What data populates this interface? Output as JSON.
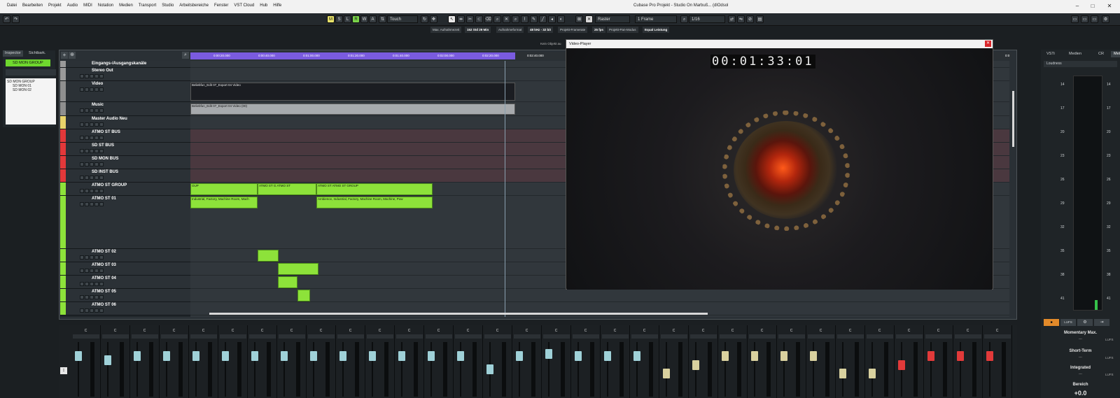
{
  "app": {
    "menu": [
      "Datei",
      "Bearbeiten",
      "Projekt",
      "Audio",
      "MIDI",
      "Notation",
      "Medien",
      "Transport",
      "Studio",
      "Arbeitsbereiche",
      "Fenster",
      "VST Cloud",
      "Hub",
      "Hilfe"
    ],
    "title": "Cubase Pro Projekt - Studio On Marbuß... (dlOdsol",
    "win_minimize": "–",
    "win_maximize": "□",
    "win_close": "✕"
  },
  "toolbar": {
    "undo_icon": "undo-icon",
    "redo_icon": "redo-icon",
    "mode_buttons": [
      "M",
      "S",
      "L",
      "R",
      "W",
      "A"
    ],
    "automation_mode": "Touch",
    "snap_type": "Raster",
    "quantize_grid": "1 Frame",
    "quantize_value": "1/16"
  },
  "statusbar": {
    "items": [
      "Max. Aufnahmezeit",
      "152 Std 29 Min",
      "Aufnahmeformat",
      "48 kHz - 32 bit",
      "Projekt-Framerate",
      "25 fps",
      "Projekt-Pan-Modus",
      "Equal Leistung"
    ]
  },
  "inspector": {
    "tabs": [
      "Inspector",
      "Sichtbark."
    ],
    "group_label": "SD MON GROUP",
    "tree": [
      "SD MON GROUP",
      "SD MON 01",
      "SD MON 02"
    ]
  },
  "project": {
    "nav_label": "",
    "ruler_labels": [
      "0:00:20.000",
      "0:00:40.000",
      "0:01:00.000",
      "0:01:20.000",
      "0:01:40.000",
      "0:02:00.000",
      "0:02:20.000",
      "0:02:40.000"
    ],
    "ruler_end": "0:0",
    "tracks": [
      {
        "name": "Eingangs-/Ausgangskanäle",
        "color": "#9a9a9a",
        "h": 10
      },
      {
        "name": "Stereo Out",
        "color": "#9a9a9a",
        "h": 19
      },
      {
        "name": "Video",
        "color": "#8f8f8f",
        "h": 30
      },
      {
        "name": "Music",
        "color": "#8f8f8f",
        "h": 20
      },
      {
        "name": "Master Audio Neu",
        "color": "#e9d36a",
        "h": 19
      },
      {
        "name": "ATMO ST BUS",
        "color": "#e3383a",
        "h": 19
      },
      {
        "name": "SD ST BUS",
        "color": "#e3383a",
        "h": 19
      },
      {
        "name": "SD MON BUS",
        "color": "#e3383a",
        "h": 19
      },
      {
        "name": "SD INST BUS",
        "color": "#e3383a",
        "h": 19
      },
      {
        "name": "ATMO ST GROUP",
        "color": "#8de23a",
        "h": 19
      },
      {
        "name": "ATMO ST 01",
        "color": "#8de23a",
        "h": 76
      },
      {
        "name": "ATMO ST 02",
        "color": "#8de23a",
        "h": 19
      },
      {
        "name": "ATMO ST 03",
        "color": "#8de23a",
        "h": 19
      },
      {
        "name": "ATMO ST 04",
        "color": "#8de23a",
        "h": 19
      },
      {
        "name": "ATMO ST 05",
        "color": "#8de23a",
        "h": 19
      },
      {
        "name": "ATMO ST 06",
        "color": "#8de23a",
        "h": 19
      }
    ],
    "events": {
      "video": "Beliebfun_Edit 07_Export 04 Video",
      "music": "Beliebfun_Edit 07_Export 04 Video (00)",
      "group1": "OUP",
      "group2": "ATMO ST G ATMO ST",
      "group3": "ATMO ST ATMO ST GROUP",
      "atmo1a": "Industrial, Factory, Machine Room, Mach",
      "atmo1b": "Ambience, Industrial, Factory, Machine Room, Machine, Pow"
    }
  },
  "video_player": {
    "title": "Video-Player",
    "close": "✕",
    "timecode": "00:01:33:01",
    "status_hint": "Kein Objekt au"
  },
  "right_panel": {
    "tabs": [
      "VSTi",
      "Medien",
      "CR",
      "Meter"
    ],
    "active_tab": "Meter",
    "loudness_label": "Loudness",
    "scale": [
      "14",
      "17",
      "20",
      "23",
      "26",
      "29",
      "32",
      "35",
      "38",
      "41"
    ],
    "unit": "LUFS",
    "momentary": "Momentary Max.",
    "momentary_val": "---",
    "shortterm": "Short-Term",
    "shortterm_val": "---",
    "integrated": "Integrated",
    "integrated_val": "---",
    "range": "Bereich",
    "range_val": "+0.0"
  },
  "mixer": {
    "strip_count": 32,
    "knob_label": "C",
    "fader_colors": [
      "#9fd1d8",
      "#9fd1d8",
      "#9fd1d8",
      "#9fd1d8",
      "#9fd1d8",
      "#9fd1d8",
      "#9fd1d8",
      "#9fd1d8",
      "#9fd1d8",
      "#9fd1d8",
      "#9fd1d8",
      "#9fd1d8",
      "#9fd1d8",
      "#9fd1d8",
      "#9fd1d8",
      "#9fd1d8",
      "#9fd1d8",
      "#9fd1d8",
      "#9fd1d8",
      "#9fd1d8",
      "#d9d19f",
      "#d9d19f",
      "#d9d19f",
      "#d9d19f",
      "#d9d19f",
      "#d9d19f",
      "#d9d19f",
      "#d9d19f",
      "#e23a3a",
      "#e23a3a",
      "#e23a3a",
      "#e23a3a"
    ],
    "fader_levels": [
      0.8,
      0.7,
      0.8,
      0.8,
      0.8,
      0.8,
      0.8,
      0.8,
      0.8,
      0.8,
      0.8,
      0.8,
      0.8,
      0.8,
      0.5,
      0.8,
      0.85,
      0.8,
      0.8,
      0.8,
      0.4,
      0.6,
      0.8,
      0.8,
      0.8,
      0.8,
      0.4,
      0.4,
      0.6,
      0.8,
      0.8,
      0.8
    ]
  }
}
